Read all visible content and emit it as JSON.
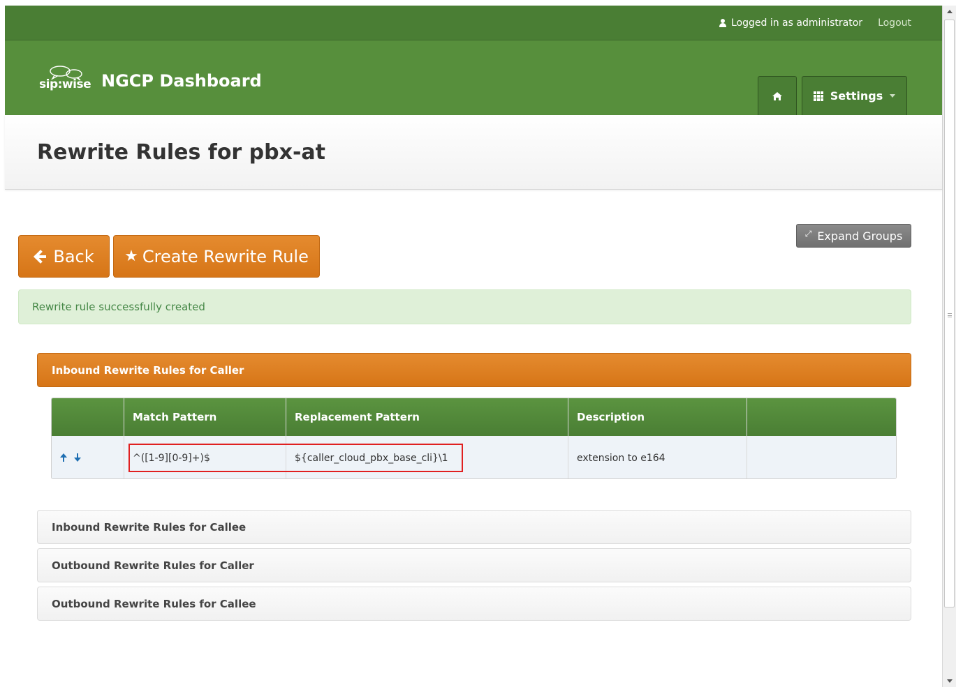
{
  "topbar": {
    "logged_in": "Logged in as administrator",
    "logout": "Logout"
  },
  "brand": {
    "logo_text": "sip:wise",
    "title": "NGCP Dashboard"
  },
  "nav": {
    "home_icon": "home-icon",
    "settings_label": "Settings"
  },
  "page": {
    "title": "Rewrite Rules for pbx-at"
  },
  "actions": {
    "back_label": "Back",
    "create_label": "Create Rewrite Rule",
    "expand_label": "Expand Groups"
  },
  "alert": {
    "message": "Rewrite rule successfully created",
    "color": "#468847"
  },
  "groups": [
    {
      "label": "Inbound Rewrite Rules for Caller",
      "expanded": true
    },
    {
      "label": "Inbound Rewrite Rules for Callee",
      "expanded": false
    },
    {
      "label": "Outbound Rewrite Rules for Caller",
      "expanded": false
    },
    {
      "label": "Outbound Rewrite Rules for Callee",
      "expanded": false
    }
  ],
  "table": {
    "headers": [
      "",
      "Match Pattern",
      "Replacement Pattern",
      "Description",
      ""
    ],
    "rows": [
      {
        "match": "^([1-9][0-9]+)$",
        "replacement": "${caller_cloud_pbx_base_cli}\\1",
        "description": "extension to e164"
      }
    ]
  },
  "colors": {
    "topbar": "#4a7e34",
    "brandbar": "#578f3c",
    "accent_orange": "#d67517",
    "highlight": "#e02020"
  }
}
